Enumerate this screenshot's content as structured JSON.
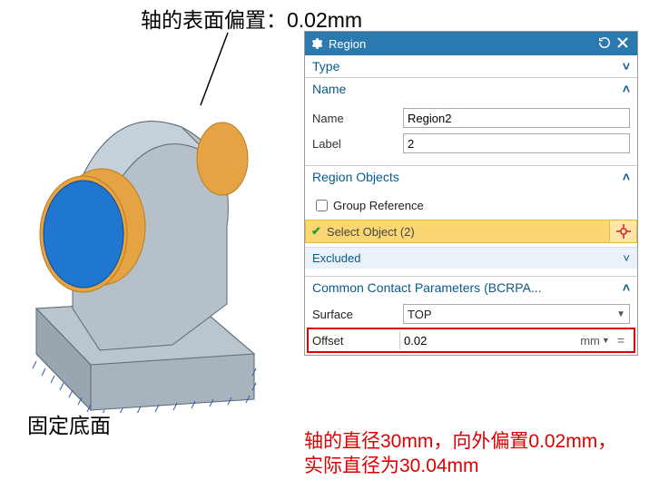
{
  "annotations": {
    "top": "轴的表面偏置：0.02mm",
    "bottom_left": "固定底面",
    "red_line1": "轴的直径30mm，向外偏置0.02mm，",
    "red_line2": "实际直径为30.04mm"
  },
  "panel": {
    "title": "Region",
    "reset_icon": "reset-icon",
    "close_icon": "close-icon",
    "sections": {
      "type": {
        "header": "Type"
      },
      "name": {
        "header": "Name",
        "name_label": "Name",
        "name_value": "Region2",
        "label_label": "Label",
        "label_value": "2"
      },
      "region_objects": {
        "header": "Region Objects",
        "group_ref_label": "Group Reference",
        "group_ref_checked": false,
        "select_object_label": "Select Object (2)",
        "excluded_label": "Excluded"
      },
      "contact": {
        "header": "Common Contact Parameters (BCRPA...",
        "surface_label": "Surface",
        "surface_value": "TOP",
        "offset_label": "Offset",
        "offset_value": "0.02",
        "offset_unit": "mm"
      }
    }
  },
  "model": {
    "description": "3D bracket with cylindrical shaft through arch, fixed base hatch pattern",
    "shaft_diameter_mm": 30,
    "surface_offset_mm": 0.02,
    "effective_diameter_mm": 30.04
  }
}
